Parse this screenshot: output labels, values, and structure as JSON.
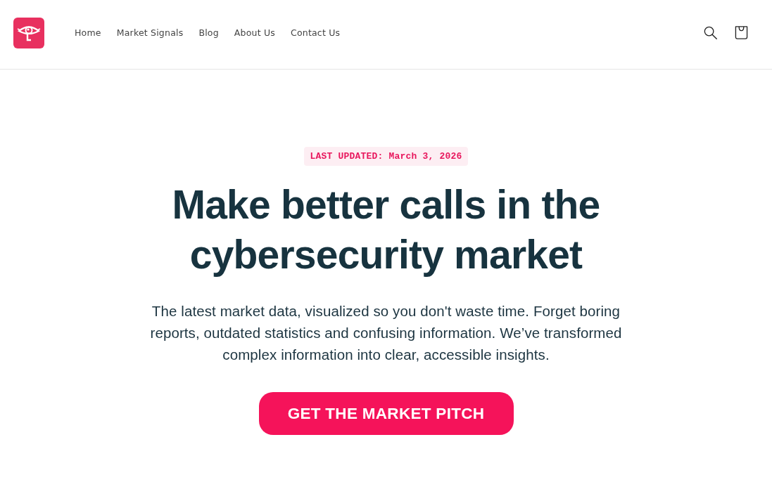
{
  "header": {
    "nav": [
      {
        "label": "Home"
      },
      {
        "label": "Market Signals"
      },
      {
        "label": "Blog"
      },
      {
        "label": "About Us"
      },
      {
        "label": "Contact Us"
      }
    ]
  },
  "hero": {
    "badge": "LAST UPDATED: March 3, 2026",
    "title_lines": [
      "Make better calls in the",
      "cybersecurity market"
    ],
    "description": "The latest market data, visualized so you don't waste time. Forget boring reports, outdated statistics and confusing information. We’ve transformed complex information into clear, accessible insights.",
    "cta": "GET THE MARKET PITCH"
  }
}
